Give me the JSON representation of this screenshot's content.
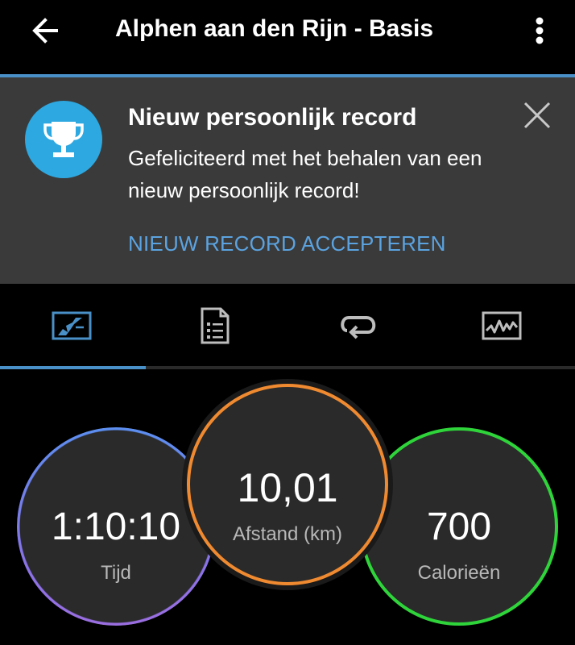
{
  "app_bar": {
    "title": "Alphen aan den Rijn - Basis",
    "back_icon": "arrow-left-icon",
    "menu_icon": "more-vert-icon"
  },
  "record_card": {
    "icon": "trophy-icon",
    "title": "Nieuw persoonlijk record",
    "message": "Gefeliciteerd met het behalen van een nieuw persoonlijk record!",
    "accept_label": "NIEUW RECORD ACCEPTEREN",
    "close_icon": "close-icon"
  },
  "tabs": [
    {
      "name": "overview",
      "icon": "map-icon",
      "selected": true
    },
    {
      "name": "details",
      "icon": "document-list-icon",
      "selected": false
    },
    {
      "name": "laps",
      "icon": "loop-icon",
      "selected": false
    },
    {
      "name": "charts",
      "icon": "chart-icon",
      "selected": false
    }
  ],
  "stats": {
    "time": {
      "value": "1:10:10",
      "label": "Tijd"
    },
    "distance": {
      "value": "10,01",
      "label": "Afstand (km)"
    },
    "calories": {
      "value": "700",
      "label": "Calorieën"
    }
  },
  "colors": {
    "accent": "#4a90c8",
    "link": "#5ba3e0",
    "trophy_bg": "#2ea8e0",
    "distance_ring": "#f08a30",
    "calories_ring": "#2ed43a",
    "time_ring_start": "#5b8ef0",
    "time_ring_end": "#9a6ee0"
  }
}
